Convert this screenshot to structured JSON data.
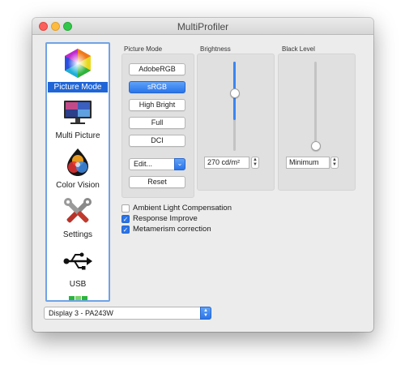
{
  "window": {
    "title": "MultiProfiler"
  },
  "sidebar": {
    "items": [
      {
        "label": "Picture Mode",
        "icon": "color-hexagon-icon",
        "selected": true
      },
      {
        "label": "Multi Picture",
        "icon": "monitor-icon",
        "selected": false
      },
      {
        "label": "Color Vision",
        "icon": "color-vision-icon",
        "selected": false
      },
      {
        "label": "Settings",
        "icon": "tools-icon",
        "selected": false
      },
      {
        "label": "USB",
        "icon": "usb-icon",
        "selected": false
      }
    ]
  },
  "picture_mode": {
    "label": "Picture Mode",
    "modes": [
      "AdobeRGB",
      "sRGB",
      "High Bright",
      "Full",
      "DCI"
    ],
    "selected": "sRGB",
    "edit_label": "Edit...",
    "reset_label": "Reset"
  },
  "brightness": {
    "label": "Brightness",
    "value": "270 cd/m²"
  },
  "black_level": {
    "label": "Black Level",
    "value": "Minimum"
  },
  "options": [
    {
      "label": "Ambient Light Compensation",
      "checked": false
    },
    {
      "label": "Response Improve",
      "checked": true
    },
    {
      "label": "Metamerism correction",
      "checked": true
    }
  ],
  "display_select": {
    "value": "Display 3 - PA243W"
  },
  "colors": {
    "accent": "#2a74ea",
    "selection": "#1f65d6",
    "sidebar_border": "#6fa3e6"
  }
}
